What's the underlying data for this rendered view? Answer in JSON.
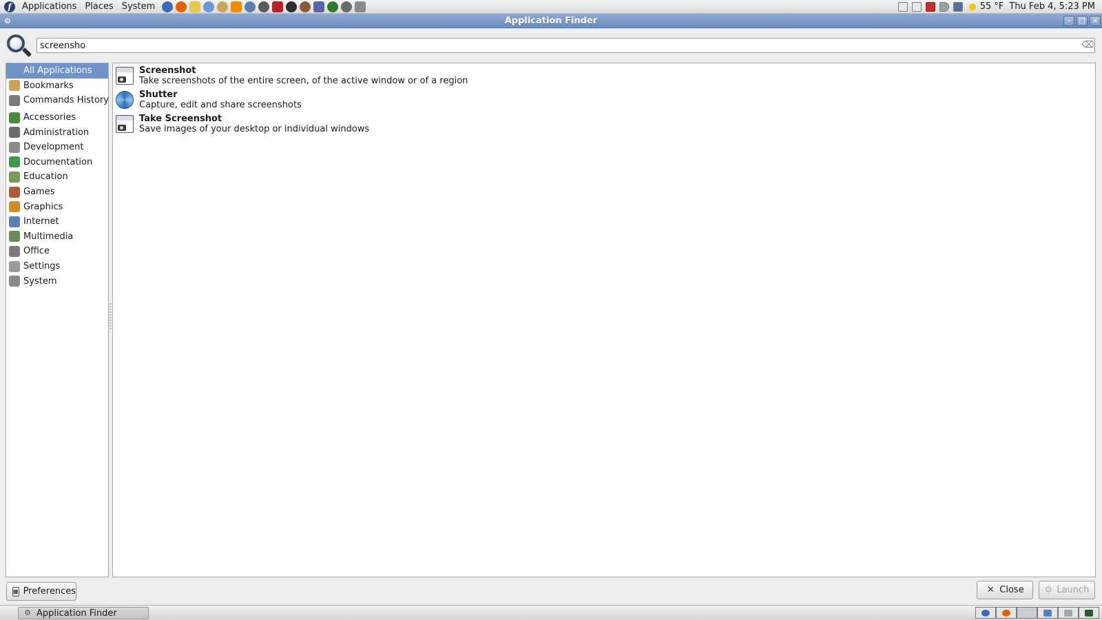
{
  "top_panel": {
    "menus": [
      "Applications",
      "Places",
      "System"
    ],
    "weather": "55 °F",
    "clock": "Thu Feb  4,  5:23 PM",
    "launcher_icons": [
      {
        "name": "thunderbird-icon",
        "color": "#3a6db5"
      },
      {
        "name": "firefox-icon",
        "color": "#e66000"
      },
      {
        "name": "folder-icon",
        "color": "#e6c84a"
      },
      {
        "name": "text-editor-icon",
        "color": "#6c98d6"
      },
      {
        "name": "gimp-icon",
        "color": "#c9a45a"
      },
      {
        "name": "vlc-icon",
        "color": "#f08a00"
      },
      {
        "name": "brush-icon",
        "color": "#5b7fb0"
      },
      {
        "name": "webcam-icon",
        "color": "#5a5a5a"
      },
      {
        "name": "media-player-icon",
        "color": "#b8202a"
      },
      {
        "name": "terminal-icon",
        "color": "#2f2f2f"
      },
      {
        "name": "tools-icon",
        "color": "#8a5b3a"
      },
      {
        "name": "pointer-icon",
        "color": "#5664a8"
      },
      {
        "name": "system-monitor-icon",
        "color": "#2d7a2d"
      },
      {
        "name": "search-icon",
        "color": "#6a6a6a"
      },
      {
        "name": "magnifier-icon",
        "color": "#8a8a8a"
      }
    ]
  },
  "window": {
    "title": "Application Finder"
  },
  "search": {
    "value": "screensho"
  },
  "sidebar": {
    "top_items": [
      {
        "label": "All Applications",
        "icon": "all-applications-icon",
        "selected": true
      },
      {
        "label": "Bookmarks",
        "icon": "bookmarks-icon"
      },
      {
        "label": "Commands History",
        "icon": "commands-history-icon"
      }
    ],
    "categories": [
      {
        "label": "Accessories",
        "icon": "accessories-icon"
      },
      {
        "label": "Administration",
        "icon": "administration-icon"
      },
      {
        "label": "Development",
        "icon": "development-icon"
      },
      {
        "label": "Documentation",
        "icon": "documentation-icon"
      },
      {
        "label": "Education",
        "icon": "education-icon"
      },
      {
        "label": "Games",
        "icon": "games-icon"
      },
      {
        "label": "Graphics",
        "icon": "graphics-icon"
      },
      {
        "label": "Internet",
        "icon": "internet-icon"
      },
      {
        "label": "Multimedia",
        "icon": "multimedia-icon"
      },
      {
        "label": "Office",
        "icon": "office-icon"
      },
      {
        "label": "Settings",
        "icon": "settings-icon"
      },
      {
        "label": "System",
        "icon": "system-icon"
      }
    ]
  },
  "results": [
    {
      "name": "Screenshot",
      "description": "Take screenshots of the entire screen, of the active window or of a region",
      "icon": "camera-icon"
    },
    {
      "name": "Shutter",
      "description": "Capture, edit and share screenshots",
      "icon": "shutter-icon"
    },
    {
      "name": "Take Screenshot",
      "description": "Save images of your desktop or individual windows",
      "icon": "camera-icon"
    }
  ],
  "buttons": {
    "preferences": "Preferences",
    "close": "Close",
    "launch": "Launch"
  },
  "taskbar": {
    "task_label": "Application Finder"
  },
  "colors": {
    "selection": "#6f93c7",
    "titlebar": "#7b98c5"
  }
}
